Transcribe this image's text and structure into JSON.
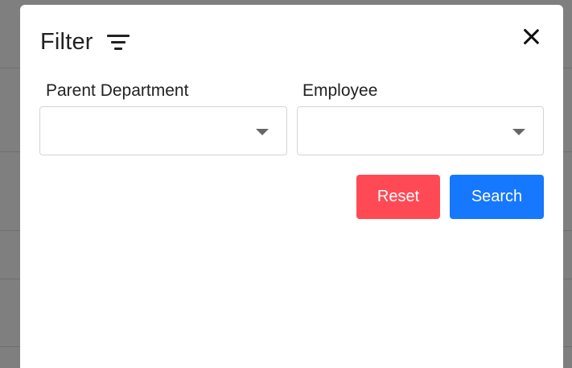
{
  "modal": {
    "title": "Filter",
    "title_icon": "filter-icon",
    "close_icon": "close-icon"
  },
  "fields": {
    "parent_department": {
      "label": "Parent Department",
      "value": ""
    },
    "employee": {
      "label": "Employee",
      "value": ""
    }
  },
  "actions": {
    "reset_label": "Reset",
    "search_label": "Search"
  },
  "colors": {
    "reset": "#ff4a55",
    "search": "#1677ff",
    "overlay": "rgba(0,0,0,0.5)"
  }
}
